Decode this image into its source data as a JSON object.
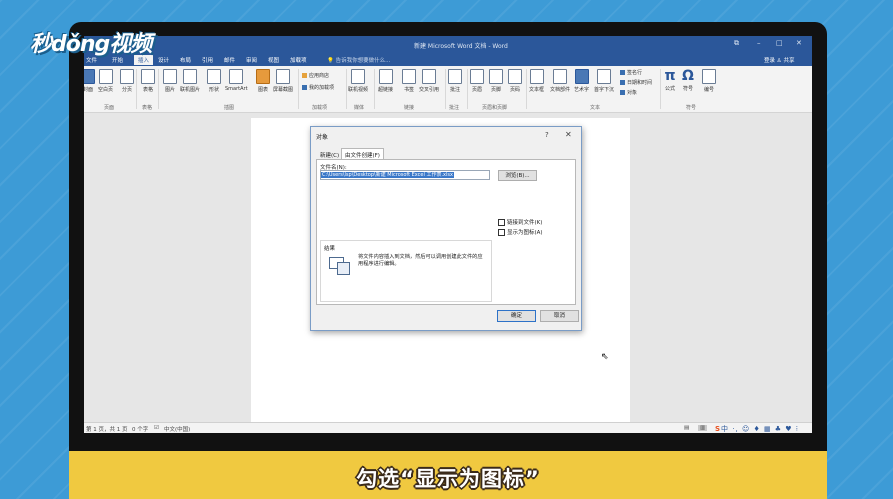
{
  "watermark": {
    "logo": "秒dǒng视频"
  },
  "window": {
    "title": "新建 Microsoft Word 文档 - Word",
    "controls": {
      "restore": "⧉",
      "minimize": "–",
      "maximize": "□",
      "close": "✕"
    },
    "login": "登录",
    "share": "共享"
  },
  "tabs": [
    {
      "label": "文件",
      "active": false
    },
    {
      "label": "开始",
      "active": false
    },
    {
      "label": "插入",
      "active": true
    },
    {
      "label": "设计",
      "active": false
    },
    {
      "label": "布局",
      "active": false
    },
    {
      "label": "引用",
      "active": false
    },
    {
      "label": "邮件",
      "active": false
    },
    {
      "label": "审阅",
      "active": false
    },
    {
      "label": "视图",
      "active": false
    },
    {
      "label": "加载项",
      "active": false
    }
  ],
  "search_placeholder": "告诉我你想要做什么...",
  "ribbon": {
    "buttons": [
      "封面",
      "空白页",
      "分页",
      "表格",
      "图片",
      "联机图片",
      "形状",
      "SmartArt",
      "图表",
      "屏幕截图",
      "联机视频",
      "超链接",
      "书签",
      "交叉引用",
      "批注",
      "页眉",
      "页脚",
      "页码",
      "文本框",
      "文档部件",
      "艺术字",
      "首字下沉",
      "公式",
      "符号",
      "编号"
    ],
    "small": [
      "应用商店",
      "我的加载项",
      "签名行",
      "日期和时间",
      "对象"
    ],
    "groups": [
      "页面",
      "表格",
      "插图",
      "加载项",
      "媒体",
      "链接",
      "批注",
      "页眉和页脚",
      "文本",
      "符号"
    ]
  },
  "status": {
    "page": "第 1 页，共 1 页",
    "words": "0 个字",
    "lang": "中文(中国)"
  },
  "ime": "中 ·, ☺ ♦ ▦ ♣ ♥ ⁝",
  "dialog": {
    "title": "对象",
    "help": "?",
    "close": "✕",
    "tabs": [
      "新建(C)",
      "由文件创建(F)"
    ],
    "filename_label": "文件名(N):",
    "filename_value": "C:\\Users\\lsp\\Desktop\\新建 Microsoft Excel 工作表.xlsx",
    "browse": "浏览(B)...",
    "link_to_file": "链接到文件(K)",
    "display_as_icon": "显示为图标(A)",
    "result_label": "结果",
    "result_text": "将文件内容插入到文档，然后可以调用创建此文件的应用程序进行编辑。",
    "ok": "确定",
    "cancel": "取消"
  },
  "caption": "勾选“显示为图标”"
}
